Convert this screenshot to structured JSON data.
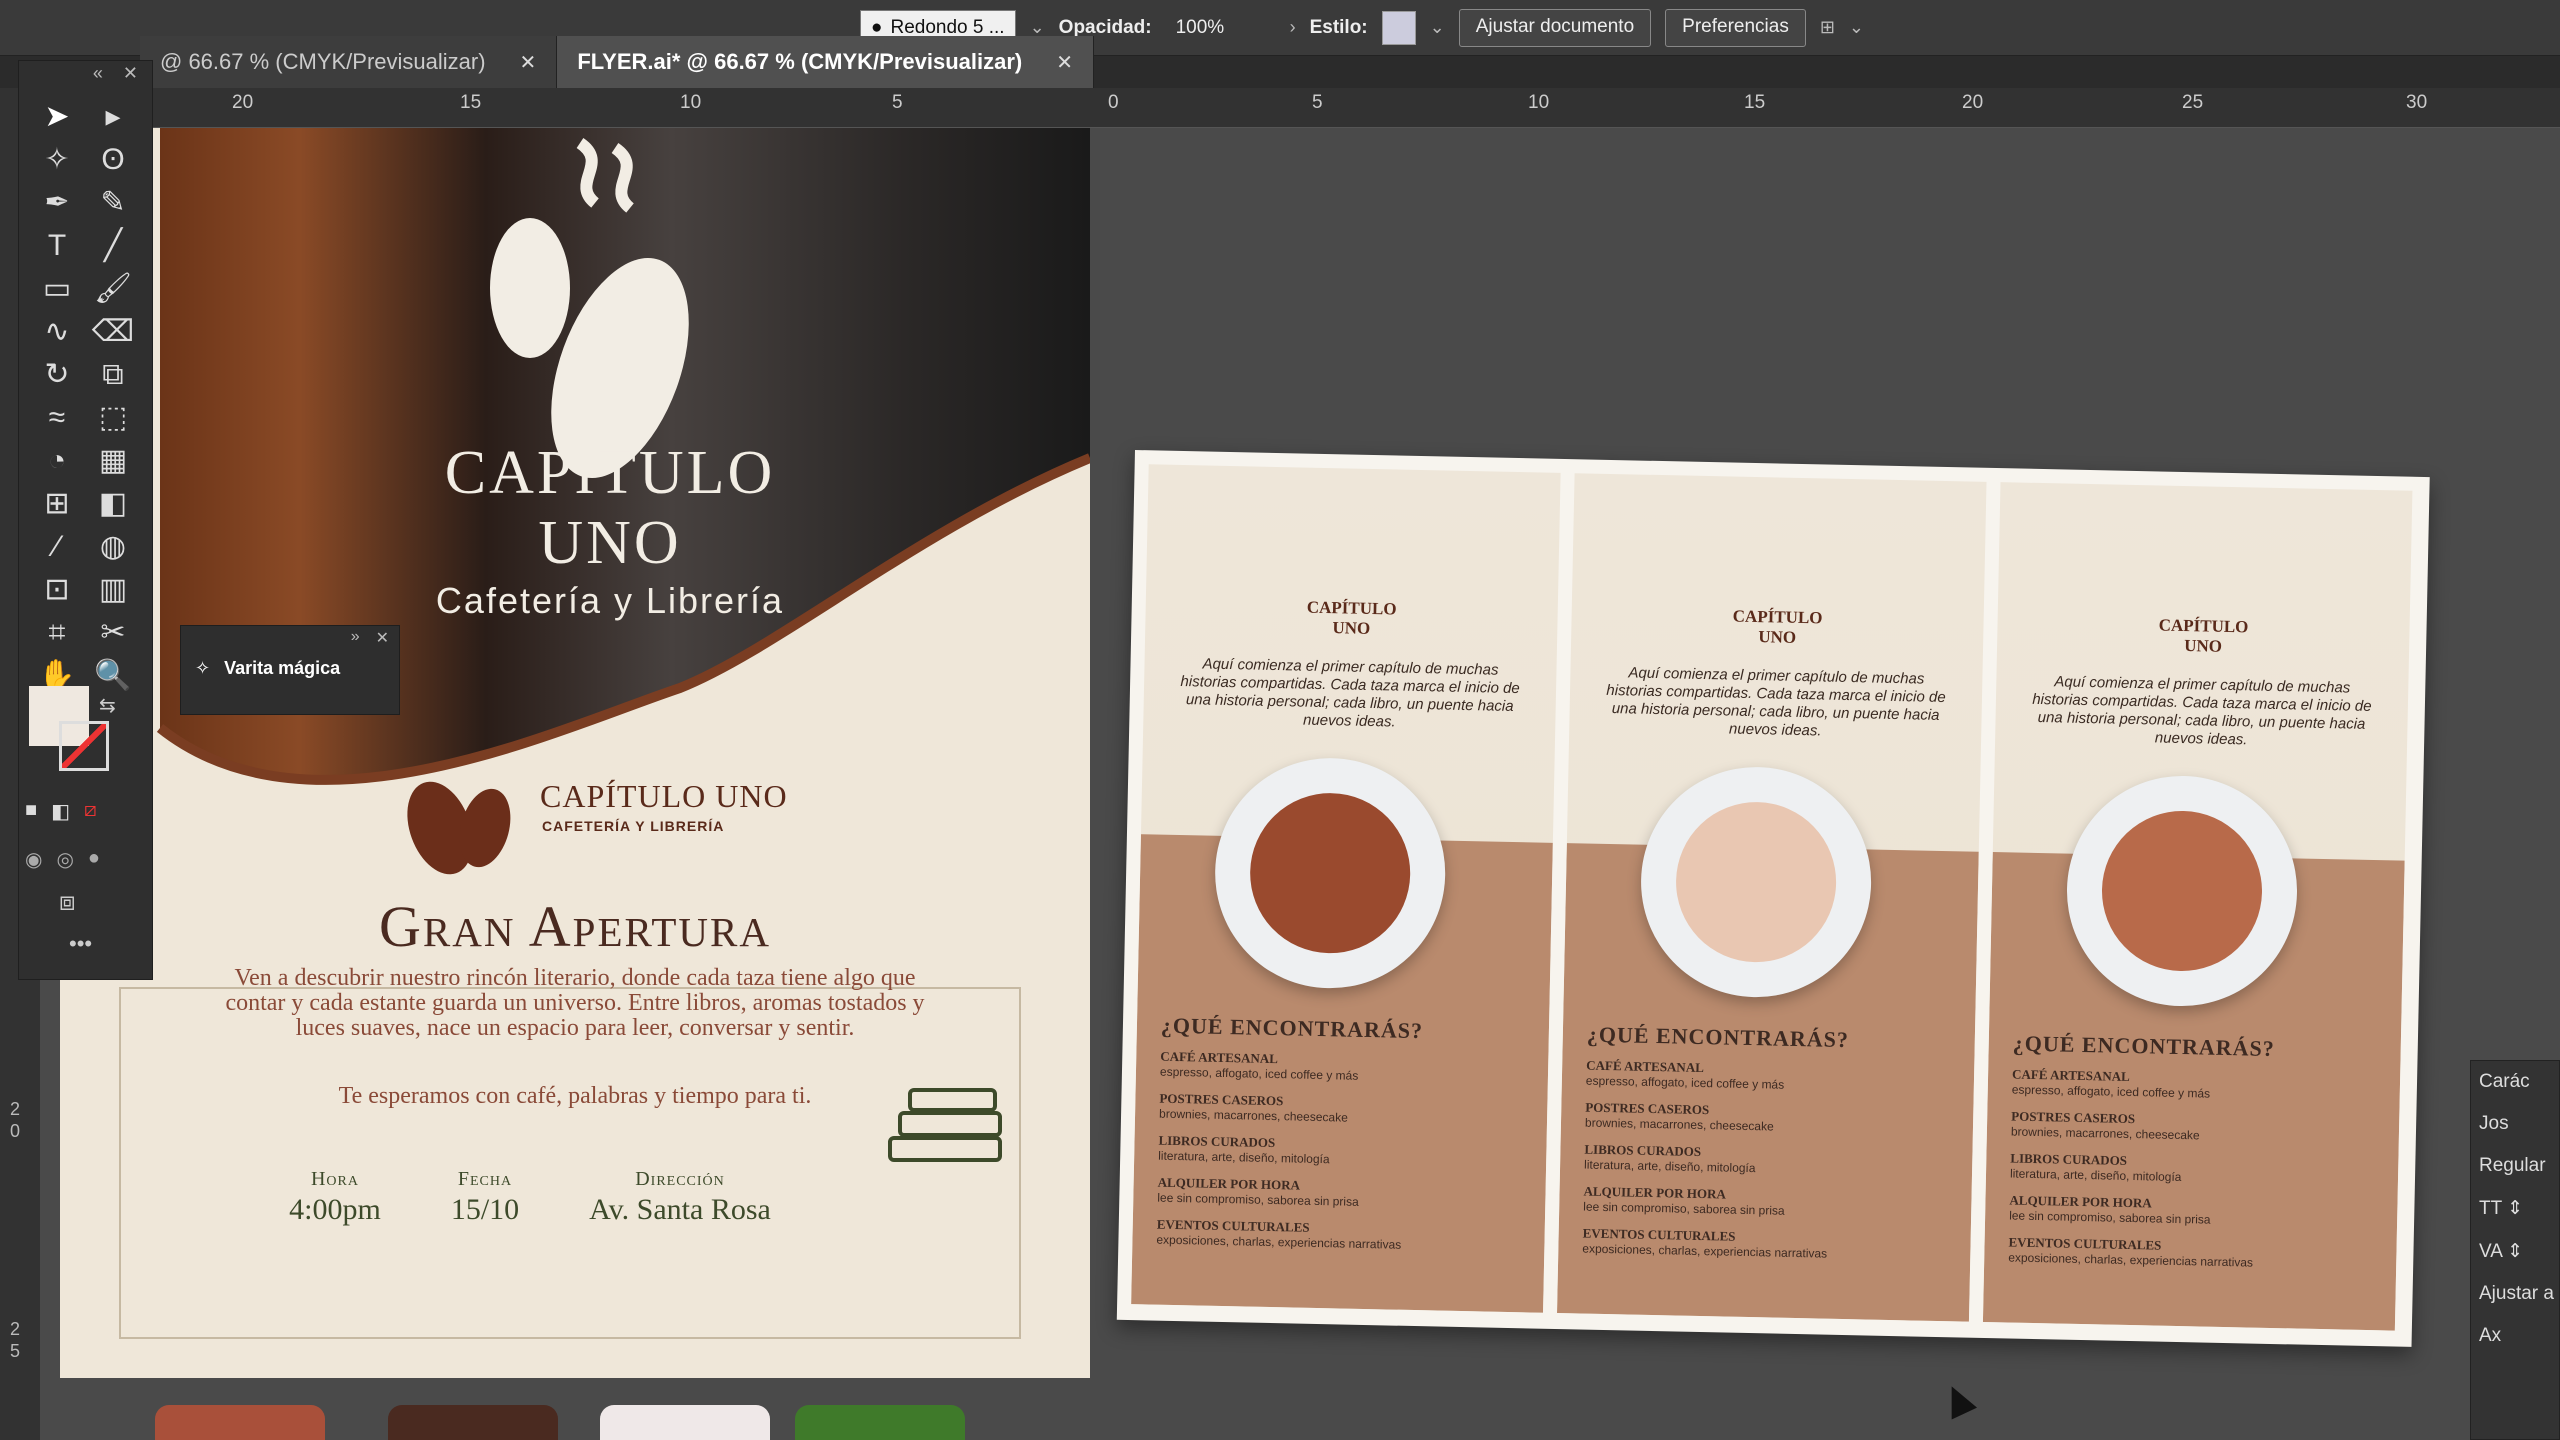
{
  "control_bar": {
    "brush_value": "Redondo 5 ...",
    "opacity_label": "Opacidad:",
    "opacity_value": "100%",
    "style_label": "Estilo:",
    "adjust_doc_label": "Ajustar documento",
    "preferences_label": "Preferencias"
  },
  "tabs": [
    {
      "label": "@ 66.67 % (CMYK/Previsualizar)",
      "active": false
    },
    {
      "label": "FLYER.ai* @ 66.67 % (CMYK/Previsualizar)",
      "active": true
    }
  ],
  "ruler": {
    "h_labels": [
      "20",
      "15",
      "10",
      "5",
      "0",
      "5",
      "10",
      "15",
      "20",
      "25",
      "30"
    ],
    "v_labels": [
      "2\n0",
      "2\n5"
    ]
  },
  "tools_panel": {
    "tooltip_label": "Varita mágica"
  },
  "flyer": {
    "title_line1": "CAPÍTULO",
    "title_line2": "UNO",
    "subtitle": "Cafetería y Librería",
    "brand_name": "CAPÍTULO UNO",
    "brand_sub": "CAFETERÍA Y LIBRERÍA",
    "heading": "Gran Apertura",
    "paragraph": "Ven a descubrir nuestro rincón literario, donde cada taza tiene algo que contar y cada estante guarda un universo. Entre libros, aromas tostados y luces suaves, nace un espacio para leer, conversar y sentir.",
    "invite": "Te esperamos con café, palabras y tiempo para ti.",
    "info": [
      {
        "label": "Hora",
        "value": "4:00pm"
      },
      {
        "label": "Fecha",
        "value": "15/10"
      },
      {
        "label": "Dirección",
        "value": "Av. Santa Rosa"
      }
    ]
  },
  "trifold": {
    "brand_line1": "CAPÍTULO",
    "brand_line2": "UNO",
    "intro": "Aquí comienza el primer capítulo de muchas historias compartidas. Cada taza marca el inicio de una historia personal; cada libro, un puente hacia nuevos ideas.",
    "heading": "¿QUÉ ENCONTRARÁS?",
    "items": [
      {
        "title": "CAFÉ ARTESANAL",
        "desc": "espresso, affogato, iced coffee y más"
      },
      {
        "title": "POSTRES CASEROS",
        "desc": "brownies, macarrones, cheesecake"
      },
      {
        "title": "LIBROS CURADOS",
        "desc": "literatura, arte, diseño, mitología"
      },
      {
        "title": "ALQUILER POR HORA",
        "desc": "lee sin compromiso, saborea sin prisa"
      },
      {
        "title": "EVENTOS CULTURALES",
        "desc": "exposiciones, charlas, experiencias narrativas"
      }
    ],
    "latte_colors": [
      "#9a4a2e",
      "#e9c7b2",
      "#b86a4a"
    ]
  },
  "char_panel": {
    "title": "Carác",
    "font": "Jos",
    "style": "Regular",
    "adjust": "Ajustar a p"
  },
  "colors": {
    "brown": "#5a2a1a",
    "olive": "#3d4a2a",
    "swatches": [
      "#a9503a",
      "#4a2a20",
      "#efe8e8",
      "#3f7a2a"
    ]
  }
}
